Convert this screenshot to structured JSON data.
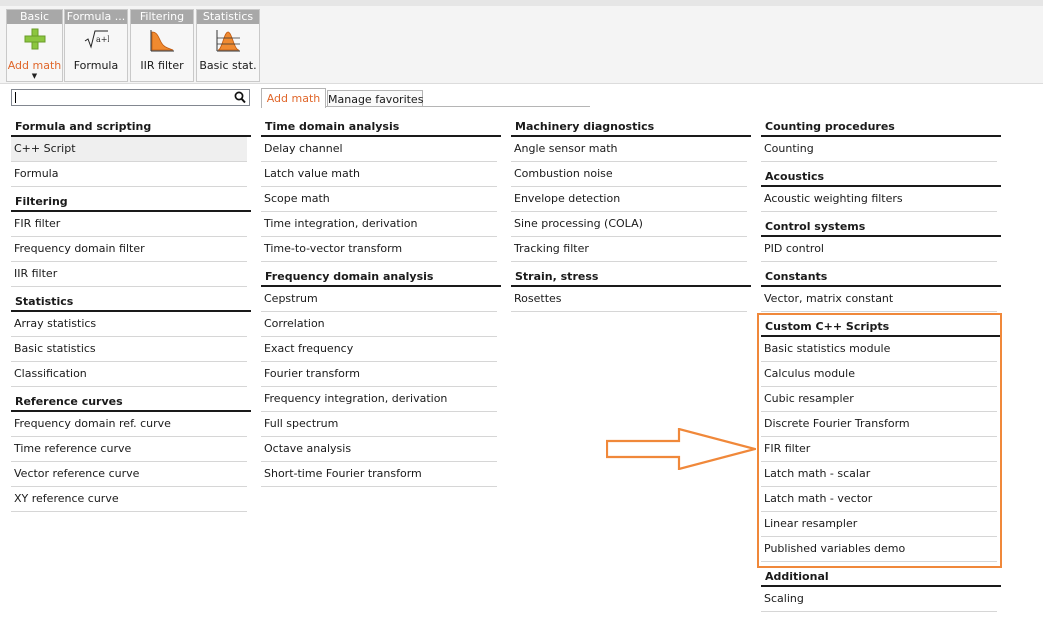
{
  "ribbon": {
    "groups": [
      {
        "title": "Basic",
        "button": "Add math",
        "icon": "green-plus-icon"
      },
      {
        "title": "Formula ...",
        "button": "Formula",
        "icon": "formula-icon"
      },
      {
        "title": "Filtering",
        "button": "IIR filter",
        "icon": "filter-curve-icon"
      },
      {
        "title": "Statistics",
        "button": "Basic stat.",
        "icon": "statistics-icon"
      }
    ]
  },
  "search": {
    "value": "",
    "placeholder": ""
  },
  "tabs": {
    "add_math": "Add math",
    "manage_favorites": "Manage favorites"
  },
  "accent_color": "#e0672b",
  "highlight_color": "#f0883a",
  "columns": [
    [
      {
        "title": "Formula and scripting",
        "items": [
          "C++ Script",
          "Formula"
        ]
      },
      {
        "title": "Filtering",
        "items": [
          "FIR filter",
          "Frequency domain filter",
          "IIR filter"
        ]
      },
      {
        "title": "Statistics",
        "items": [
          "Array statistics",
          "Basic statistics",
          "Classification"
        ]
      },
      {
        "title": "Reference curves",
        "items": [
          "Frequency domain ref. curve",
          "Time reference curve",
          "Vector reference curve",
          "XY reference curve"
        ]
      }
    ],
    [
      {
        "title": "Time domain analysis",
        "items": [
          "Delay channel",
          "Latch value math",
          "Scope math",
          "Time integration, derivation",
          "Time-to-vector transform"
        ]
      },
      {
        "title": "Frequency domain analysis",
        "items": [
          "Cepstrum",
          "Correlation",
          "Exact frequency",
          "Fourier transform",
          "Frequency integration, derivation",
          "Full spectrum",
          "Octave analysis",
          "Short-time Fourier transform"
        ]
      }
    ],
    [
      {
        "title": "Machinery diagnostics",
        "items": [
          "Angle sensor math",
          "Combustion noise",
          "Envelope detection",
          "Sine processing (COLA)",
          "Tracking filter"
        ]
      },
      {
        "title": "Strain, stress",
        "items": [
          "Rosettes"
        ]
      }
    ],
    [
      {
        "title": "Counting procedures",
        "items": [
          "Counting"
        ]
      },
      {
        "title": "Acoustics",
        "items": [
          "Acoustic weighting filters"
        ]
      },
      {
        "title": "Control systems",
        "items": [
          "PID control"
        ]
      },
      {
        "title": "Constants",
        "items": [
          "Vector, matrix constant"
        ]
      },
      {
        "title": "Custom C++ Scripts",
        "items": [
          "Basic statistics module",
          "Calculus module",
          "Cubic resampler",
          "Discrete Fourier Transform",
          "FIR filter",
          "Latch math - scalar",
          "Latch math - vector",
          "Linear resampler",
          "Published variables demo"
        ]
      },
      {
        "title": "Additional",
        "items": [
          "Scaling"
        ]
      }
    ]
  ]
}
